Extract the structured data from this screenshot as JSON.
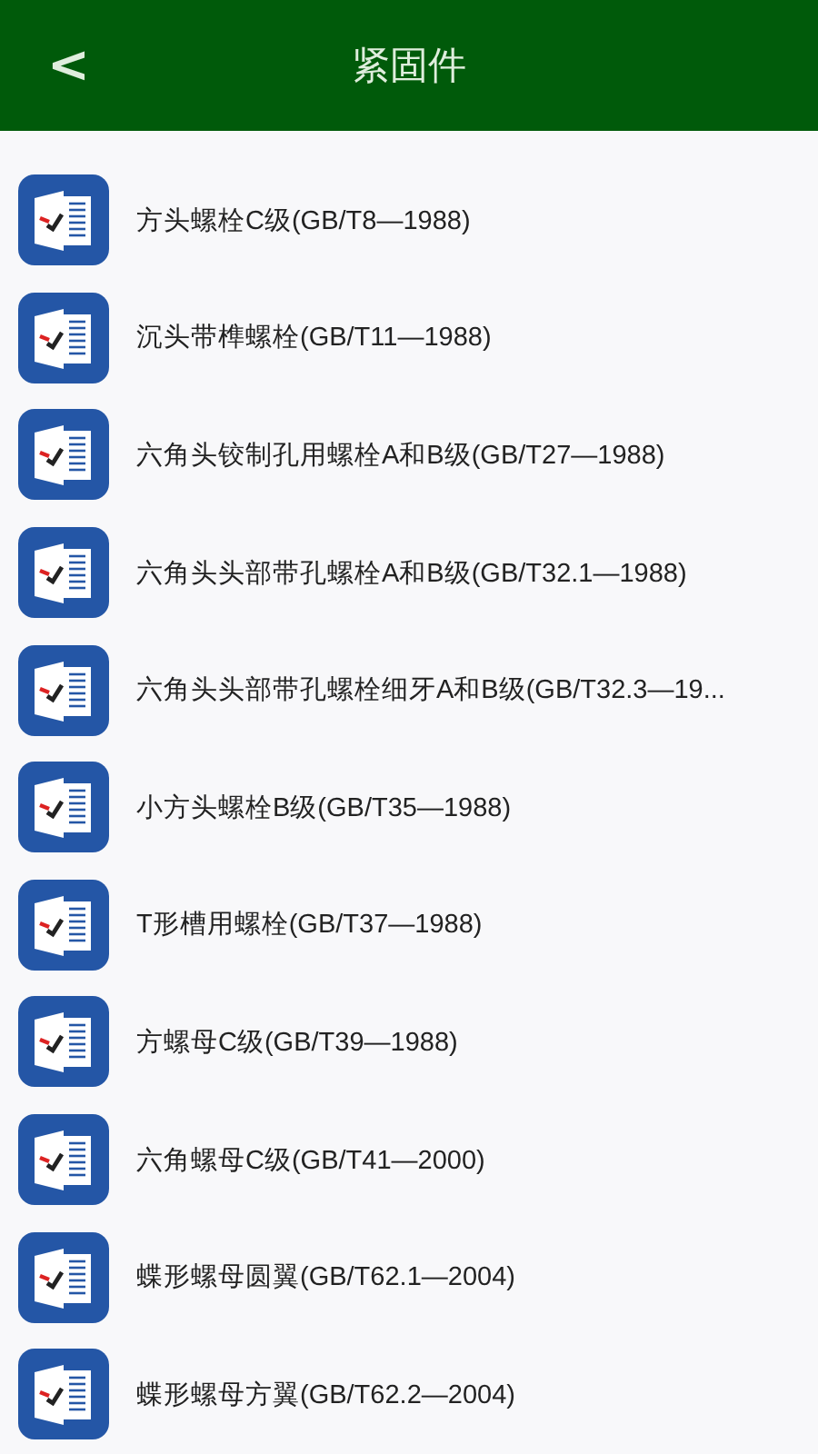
{
  "header": {
    "back": "<",
    "title": "紧固件"
  },
  "items": [
    {
      "label": "方头螺栓C级(GB/T8—1988)"
    },
    {
      "label": "沉头带榫螺栓(GB/T11—1988)"
    },
    {
      "label": "六角头铰制孔用螺栓A和B级(GB/T27—1988)"
    },
    {
      "label": "六角头头部带孔螺栓A和B级(GB/T32.1—1988)"
    },
    {
      "label": "六角头头部带孔螺栓细牙A和B级(GB/T32.3—19..."
    },
    {
      "label": "小方头螺栓B级(GB/T35—1988)"
    },
    {
      "label": "T形槽用螺栓(GB/T37—1988)"
    },
    {
      "label": "方螺母C级(GB/T39—1988)"
    },
    {
      "label": "六角螺母C级(GB/T41—2000)"
    },
    {
      "label": "蝶形螺母圆翼(GB/T62.1—2004)"
    },
    {
      "label": "蝶形螺母方翼(GB/T62.2—2004)"
    }
  ]
}
